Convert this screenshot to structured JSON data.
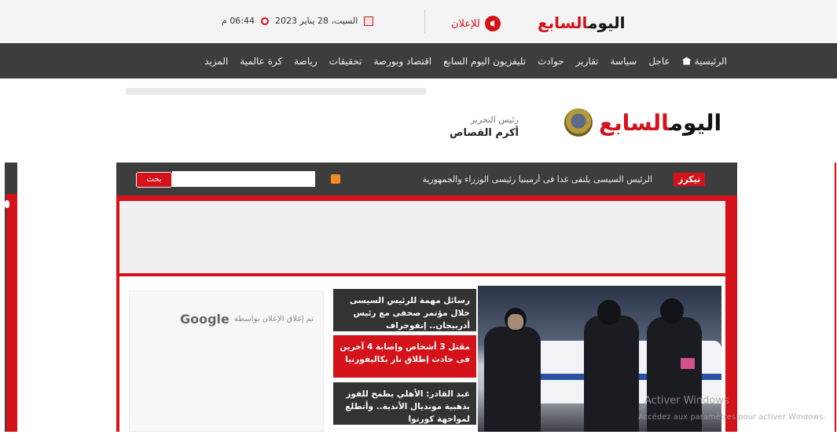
{
  "topbar": {
    "logo": {
      "part1": "اليوم",
      "part2": "السابع"
    },
    "advertise_label": "للإعلان",
    "date": "السبت، 28 يناير 2023",
    "time": "06:44 م"
  },
  "nav": {
    "items": [
      "الرئيسية",
      "عاجل",
      "سياسة",
      "تقارير",
      "حوادث",
      "تليفزيون اليوم السابع",
      "اقتصاد وبورصة",
      "تحقيقات",
      "رياضة",
      "كرة عالمية",
      "المزيد"
    ]
  },
  "header": {
    "logo": {
      "part1": "اليوم",
      "part2": "السابع"
    },
    "editor_title": "رئيس التحرير",
    "editor_name": "أكرم القصاص"
  },
  "ticker": {
    "badge": "تيكرز",
    "text": "الرئيس السيسى يلتقى غدا فى أرمينيا رئيسى الوزراء والجمهورية",
    "search_button": "بحث",
    "search_value": ""
  },
  "ad": {
    "closed_text": "تم إغلاق الإعلان بواسطة",
    "google": "Google"
  },
  "news": [
    {
      "title": "رسائل مهمة للرئيس السيسى خلال مؤتمر صحفى مع رئيس أذربيجان.. إنفوجراف"
    },
    {
      "title": "مقتل 3 أشخاص وإصابة 4 آخرين فى حادث إطلاق نار بكاليفورنيا"
    },
    {
      "title": "عبد القادر: الأهلي يطمح للفوز بذهبية مونديال الأندية.. وأتطلع لمواجهة كورتوا"
    }
  ],
  "watermark": {
    "line1": "Activer Windows",
    "line2": "Accédez aux paramètres pour activer Windows."
  },
  "colors": {
    "accent": "#d3121a",
    "nav_bg": "#3d3d3d"
  }
}
